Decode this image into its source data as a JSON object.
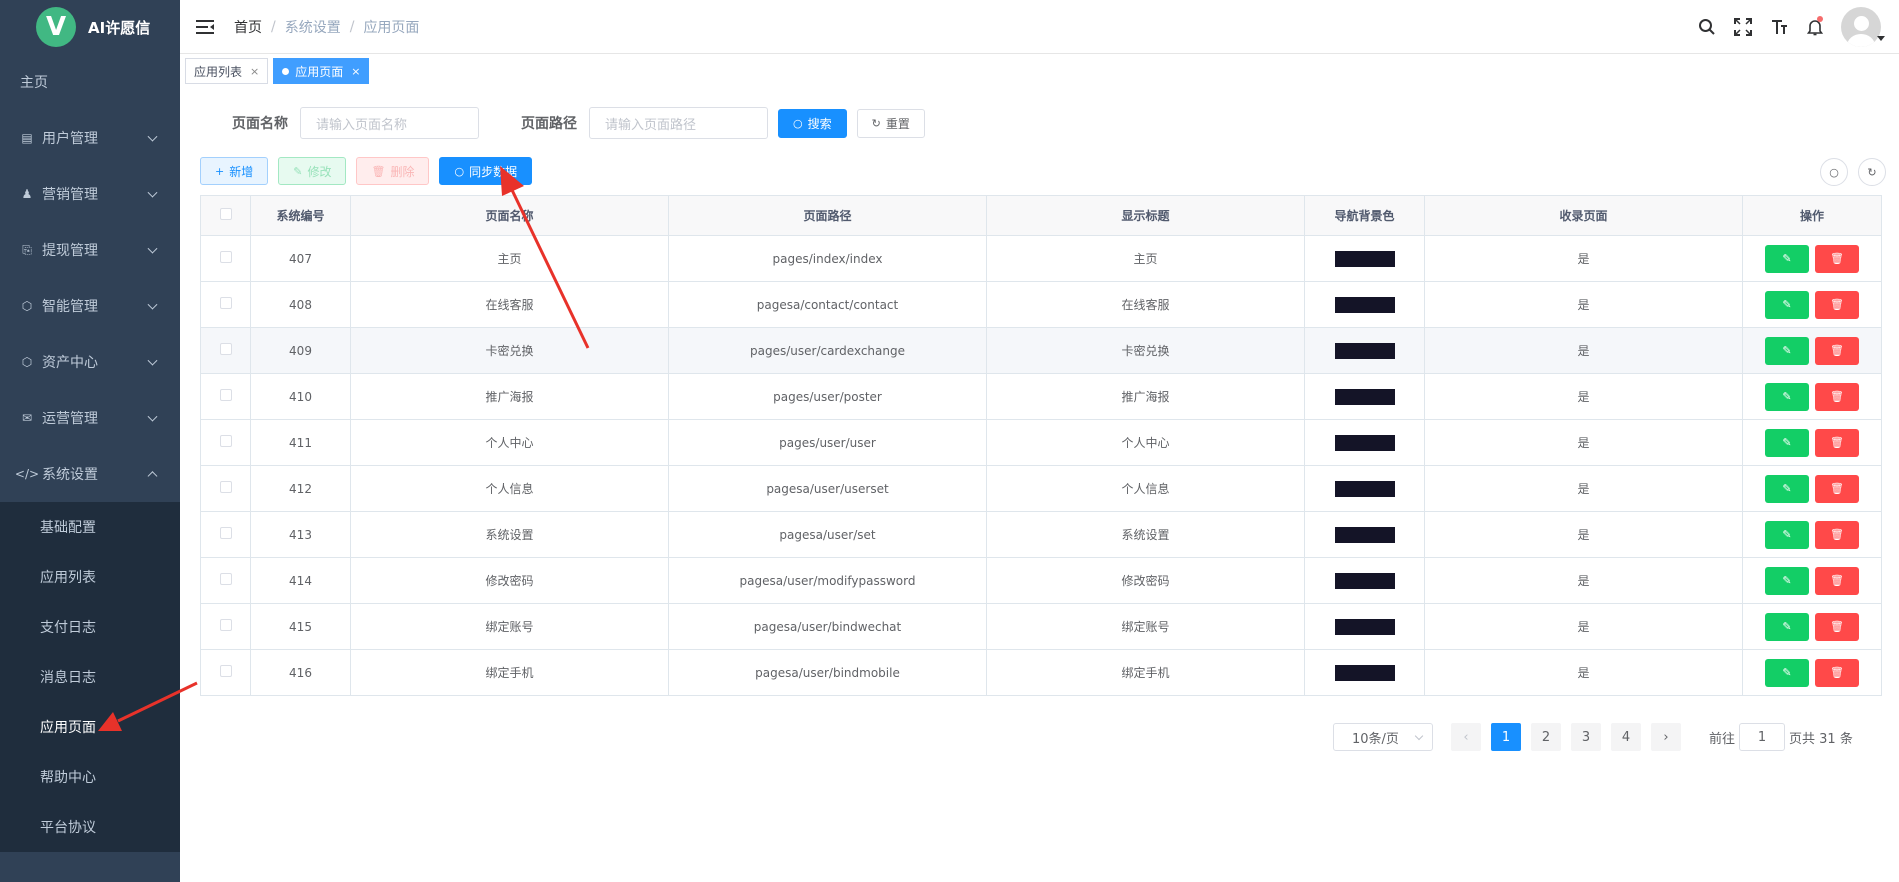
{
  "brand": {
    "logo_letter": "V",
    "name": "AI许愿信"
  },
  "sidebar": {
    "home": "主页",
    "items": [
      {
        "label": "用户管理",
        "icon": "list-icon"
      },
      {
        "label": "营销管理",
        "icon": "people-icon"
      },
      {
        "label": "提现管理",
        "icon": "withdraw-icon"
      },
      {
        "label": "智能管理",
        "icon": "cube-icon"
      },
      {
        "label": "资产中心",
        "icon": "cube-icon"
      },
      {
        "label": "运营管理",
        "icon": "mail-icon"
      },
      {
        "label": "系统设置",
        "icon": "code-icon"
      }
    ],
    "sub_items": [
      "基础配置",
      "应用列表",
      "支付日志",
      "消息日志",
      "应用页面",
      "帮助中心",
      "平台协议"
    ]
  },
  "breadcrumb": {
    "first": "首页",
    "second": "系统设置",
    "third": "应用页面"
  },
  "tags": {
    "tag1": "应用列表",
    "tag2": "应用页面"
  },
  "search": {
    "name_label": "页面名称",
    "name_placeholder": "请输入页面名称",
    "path_label": "页面路径",
    "path_placeholder": "请输入页面路径",
    "search_btn": "搜索",
    "reset_btn": "重置"
  },
  "toolbar": {
    "add": "新增",
    "edit": "修改",
    "delete": "删除",
    "sync": "同步数据"
  },
  "table": {
    "headers": [
      "系统编号",
      "页面名称",
      "页面路径",
      "显示标题",
      "导航背景色",
      "收录页面",
      "操作"
    ],
    "rows": [
      {
        "id": "407",
        "name": "主页",
        "path": "pages/index/index",
        "title": "主页",
        "included": "是"
      },
      {
        "id": "408",
        "name": "在线客服",
        "path": "pagesa/contact/contact",
        "title": "在线客服",
        "included": "是"
      },
      {
        "id": "409",
        "name": "卡密兑换",
        "path": "pages/user/cardexchange",
        "title": "卡密兑换",
        "included": "是"
      },
      {
        "id": "410",
        "name": "推广海报",
        "path": "pages/user/poster",
        "title": "推广海报",
        "included": "是"
      },
      {
        "id": "411",
        "name": "个人中心",
        "path": "pages/user/user",
        "title": "个人中心",
        "included": "是"
      },
      {
        "id": "412",
        "name": "个人信息",
        "path": "pagesa/user/userset",
        "title": "个人信息",
        "included": "是"
      },
      {
        "id": "413",
        "name": "系统设置",
        "path": "pagesa/user/set",
        "title": "系统设置",
        "included": "是"
      },
      {
        "id": "414",
        "name": "修改密码",
        "path": "pagesa/user/modifypassword",
        "title": "修改密码",
        "included": "是"
      },
      {
        "id": "415",
        "name": "绑定账号",
        "path": "pagesa/user/bindwechat",
        "title": "绑定账号",
        "included": "是"
      },
      {
        "id": "416",
        "name": "绑定手机",
        "path": "pagesa/user/bindmobile",
        "title": "绑定手机",
        "included": "是"
      }
    ]
  },
  "pagination": {
    "page_size": "10条/页",
    "pages": [
      "1",
      "2",
      "3",
      "4"
    ],
    "goto_label": "前往",
    "current": "1",
    "total_text": "页共 31 条"
  },
  "colors": {
    "sidebar_bg": "#304156",
    "primary": "#1890ff",
    "success": "#13ce66",
    "danger": "#ff4949",
    "nav_color_swatch": "#141427",
    "arrow": "#e8322a"
  }
}
